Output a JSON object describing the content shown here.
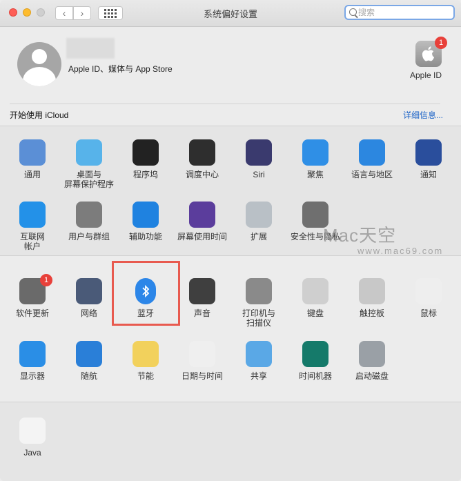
{
  "window": {
    "title": "系统偏好设置"
  },
  "search": {
    "placeholder": "搜索"
  },
  "account": {
    "subtitle": "Apple ID、媒体与 App Store",
    "appleid_label": "Apple ID",
    "appleid_badge": "1",
    "icloud_prompt": "开始使用 iCloud",
    "details_link": "详细信息..."
  },
  "row1": [
    {
      "label": "通用",
      "icon": "general-icon",
      "color": "#5b8fd6"
    },
    {
      "label": "桌面与\n屏幕保护程序",
      "icon": "desktop-icon",
      "color": "#57b3ea"
    },
    {
      "label": "程序坞",
      "icon": "dock-icon",
      "color": "#222222"
    },
    {
      "label": "调度中心",
      "icon": "mission-control-icon",
      "color": "#2e2e2e"
    },
    {
      "label": "Siri",
      "icon": "siri-icon",
      "color": "#3a3a6e"
    },
    {
      "label": "聚焦",
      "icon": "spotlight-icon",
      "color": "#2f8fe6"
    },
    {
      "label": "语言与地区",
      "icon": "language-icon",
      "color": "#2c87e0"
    },
    {
      "label": "通知",
      "icon": "notifications-icon",
      "color": "#2a4e9c"
    }
  ],
  "row2": [
    {
      "label": "互联网\n帐户",
      "icon": "internet-accounts-icon",
      "color": "#2391e8"
    },
    {
      "label": "用户与群组",
      "icon": "users-icon",
      "color": "#7c7c7c"
    },
    {
      "label": "辅助功能",
      "icon": "accessibility-icon",
      "color": "#1f82e0"
    },
    {
      "label": "屏幕使用时间",
      "icon": "screen-time-icon",
      "color": "#5b3d9c"
    },
    {
      "label": "扩展",
      "icon": "extensions-icon",
      "color": "#b9c0c6"
    },
    {
      "label": "安全性与隐私",
      "icon": "security-icon",
      "color": "#6f6f6f"
    }
  ],
  "row3": [
    {
      "label": "软件更新",
      "icon": "software-update-icon",
      "color": "#6a6a6a",
      "badge": "1"
    },
    {
      "label": "网络",
      "icon": "network-icon",
      "color": "#4a5a78"
    },
    {
      "label": "蓝牙",
      "icon": "bluetooth-icon",
      "color": "#2c86e8"
    },
    {
      "label": "声音",
      "icon": "sound-icon",
      "color": "#3f3f3f"
    },
    {
      "label": "打印机与\n扫描仪",
      "icon": "printer-icon",
      "color": "#8a8a8a"
    },
    {
      "label": "键盘",
      "icon": "keyboard-icon",
      "color": "#cfcfcf"
    },
    {
      "label": "触控板",
      "icon": "trackpad-icon",
      "color": "#c8c8c8"
    },
    {
      "label": "鼠标",
      "icon": "mouse-icon",
      "color": "#eeeeee"
    }
  ],
  "row4": [
    {
      "label": "显示器",
      "icon": "display-icon",
      "color": "#2a8ee6"
    },
    {
      "label": "随航",
      "icon": "sidecar-icon",
      "color": "#2a7fd8"
    },
    {
      "label": "节能",
      "icon": "energy-saver-icon",
      "color": "#f2d15c"
    },
    {
      "label": "日期与时间",
      "icon": "date-time-icon",
      "color": "#efefef"
    },
    {
      "label": "共享",
      "icon": "sharing-icon",
      "color": "#5aa8e6"
    },
    {
      "label": "时间机器",
      "icon": "time-machine-icon",
      "color": "#157a6a"
    },
    {
      "label": "启动磁盘",
      "icon": "startup-disk-icon",
      "color": "#9aa0a6"
    }
  ],
  "row5": [
    {
      "label": "Java",
      "icon": "java-icon",
      "color": "#f4f4f4"
    }
  ],
  "watermark": {
    "main": "Mac天空",
    "sub": "www.mac69.com"
  }
}
